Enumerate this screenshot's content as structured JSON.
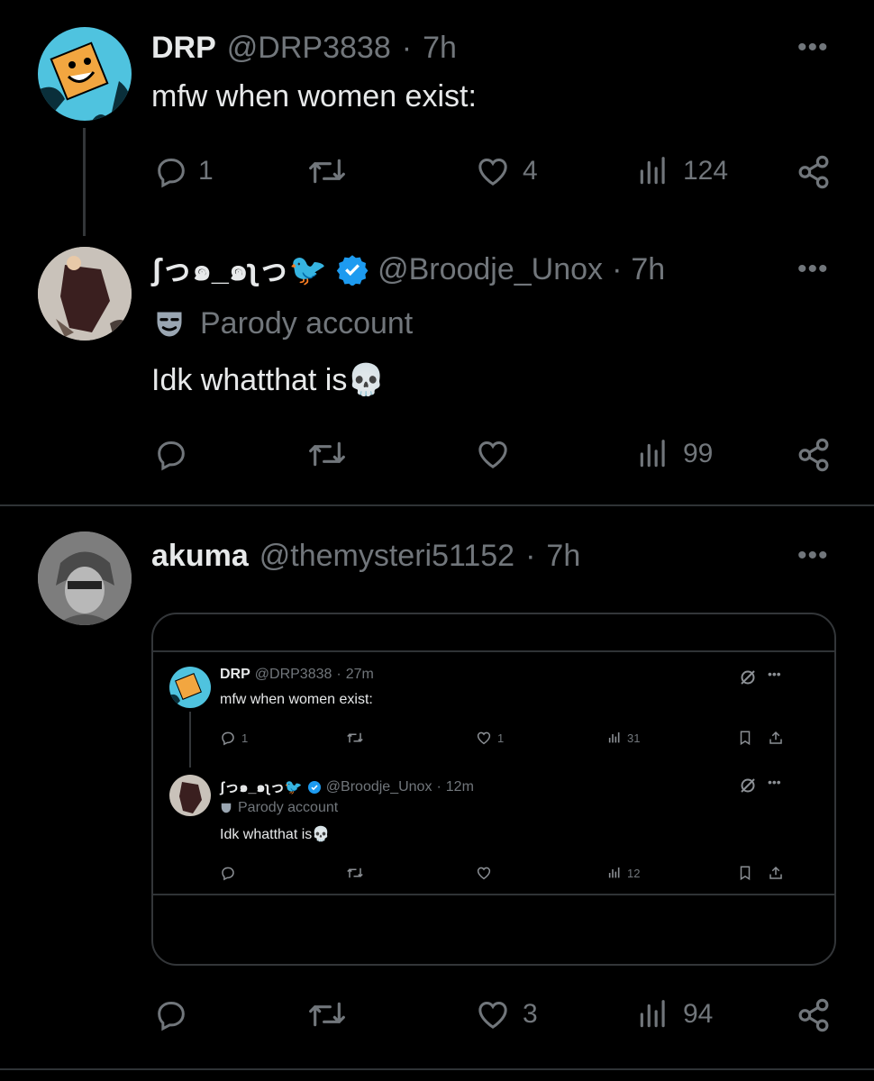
{
  "tweet1": {
    "display_name": "DRP",
    "handle": "@DRP3838",
    "time": "7h",
    "text": "mfw when women exist:",
    "replies": "1",
    "likes": "4",
    "views": "124"
  },
  "tweet2": {
    "display_name": "ʃっ๑_๑ʅっ🐦",
    "handle": "@Broodje_Unox",
    "time": "7h",
    "label": "Parody account",
    "text": "Idk whatthat is💀",
    "views": "99"
  },
  "tweet3": {
    "display_name": "akuma",
    "handle": "@themysteri51152",
    "time": "7h",
    "likes": "3",
    "views": "94"
  },
  "embed": {
    "t1": {
      "display_name": "DRP",
      "handle": "@DRP3838",
      "time": "27m",
      "text": "mfw when women exist:",
      "replies": "1",
      "likes": "1",
      "views": "31"
    },
    "t2": {
      "display_name": "ʃっ๑_๑ʅっ🐦",
      "handle": "@Broodje_Unox",
      "time": "12m",
      "label": "Parody account",
      "text": "Idk whatthat is💀",
      "views": "12"
    }
  },
  "colors": {
    "background": "#000000",
    "text": "#e7e9ea",
    "muted": "#71767b",
    "verified": "#1d9bf0",
    "divider": "#2f3336"
  },
  "icons": [
    "reply-icon",
    "retweet-icon",
    "like-icon",
    "views-icon",
    "share-icon",
    "more-icon",
    "verified-icon",
    "parody-mask-icon",
    "bookmark-icon",
    "upload-icon",
    "grok-icon"
  ]
}
